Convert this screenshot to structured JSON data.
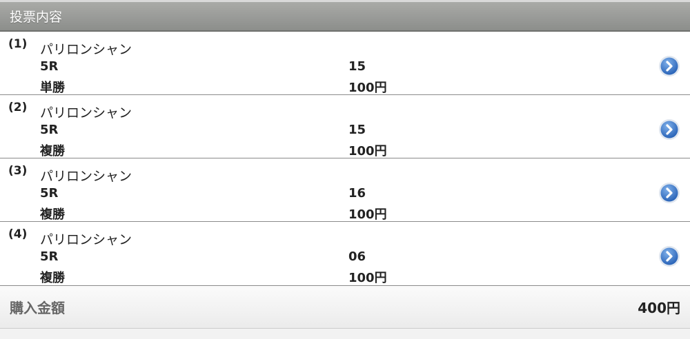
{
  "header": {
    "title": "投票内容"
  },
  "bets": [
    {
      "number": "(1)",
      "horse": "パリロンシャン",
      "race": "5R",
      "combination": "15",
      "bet_type": "単勝",
      "amount": "100円"
    },
    {
      "number": "(2)",
      "horse": "パリロンシャン",
      "race": "5R",
      "combination": "15",
      "bet_type": "複勝",
      "amount": "100円"
    },
    {
      "number": "(3)",
      "horse": "パリロンシャン",
      "race": "5R",
      "combination": "16",
      "bet_type": "複勝",
      "amount": "100円"
    },
    {
      "number": "(4)",
      "horse": "パリロンシャン",
      "race": "5R",
      "combination": "06",
      "bet_type": "複勝",
      "amount": "100円"
    }
  ],
  "footer": {
    "total_label": "購入金額",
    "total_value": "400円"
  },
  "icons": {
    "row_arrow": "chevron-right-circle-icon"
  },
  "colors": {
    "header_bg": "#9c9d9a",
    "arrow_blue": "#3a78c8"
  }
}
